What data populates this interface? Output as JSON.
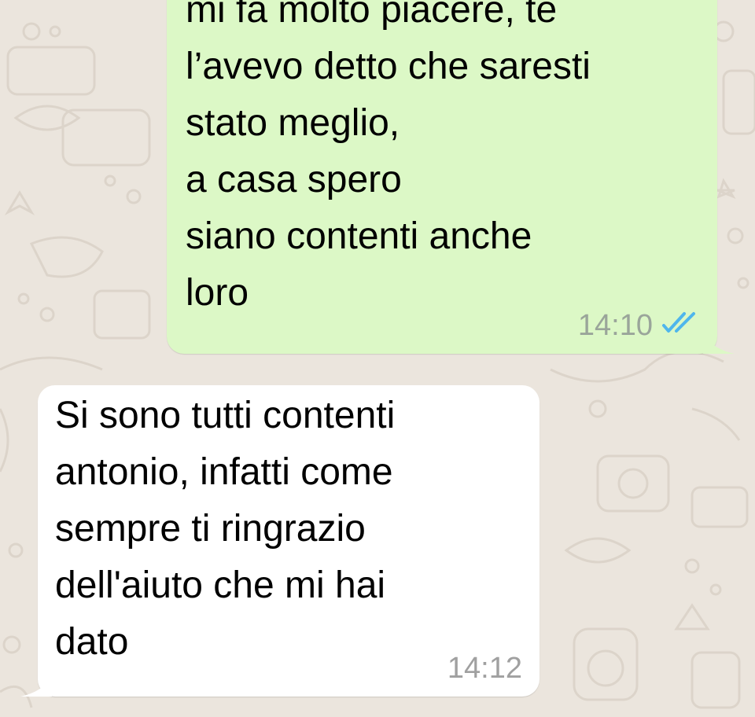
{
  "colors": {
    "background": "#ebe5dd",
    "outgoing_bubble": "#dcf8c6",
    "incoming_bubble": "#ffffff",
    "read_ticks": "#4fb6ec",
    "timestamp": "#9aa59a"
  },
  "messages": [
    {
      "direction": "outgoing",
      "text": "mi fa molto piacere, te\nl’avevo detto che saresti\nstato meglio,\na casa spero\nsiano contenti anche\nloro",
      "time": "14:10",
      "status_icon": "double-check-read-icon"
    },
    {
      "direction": "incoming",
      "text": "Si sono tutti contenti\nantonio, infatti come\nsempre ti ringrazio\ndell'aiuto che mi hai\ndato",
      "time": "14:12"
    }
  ]
}
